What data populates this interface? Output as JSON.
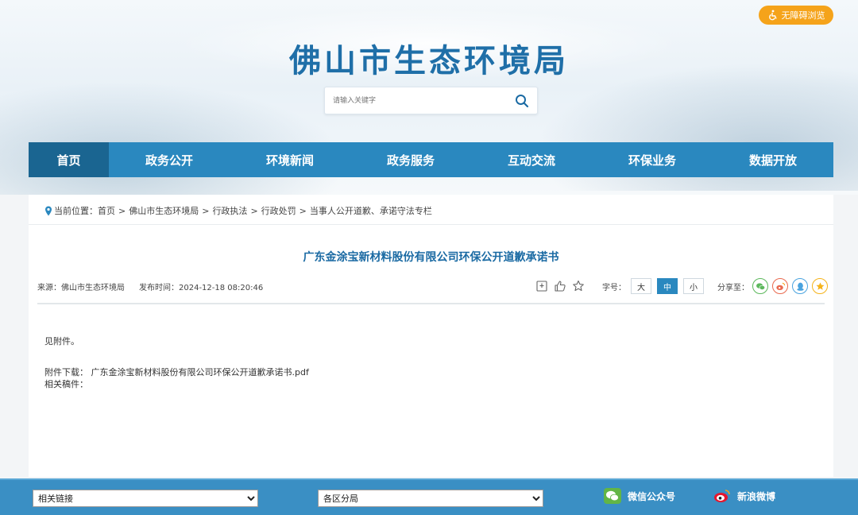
{
  "header": {
    "accessibility_label": "无障碍浏览",
    "site_title": "佛山市生态环境局",
    "search_placeholder": "请输入关键字"
  },
  "nav": {
    "items": [
      {
        "label": "首页",
        "active": true
      },
      {
        "label": "政务公开"
      },
      {
        "label": "环境新闻"
      },
      {
        "label": "政务服务"
      },
      {
        "label": "互动交流"
      },
      {
        "label": "环保业务"
      },
      {
        "label": "数据开放"
      }
    ]
  },
  "breadcrumb": {
    "prefix": "当前位置：",
    "items": [
      "首页",
      "佛山市生态环境局",
      "行政执法",
      "行政处罚",
      "当事人公开道歉、承诺守法专栏"
    ],
    "separator": ">"
  },
  "article": {
    "title": "广东金涂宝新材料股份有限公司环保公开道歉承诺书",
    "source_label": "来源：佛山市生态环境局",
    "published_label": "发布时间：2024-12-18 08:20:46",
    "font_size_label": "字号：",
    "font_sizes": [
      "大",
      "中",
      "小"
    ],
    "font_size_selected": "中",
    "share_label": "分享至：",
    "body": "见附件。",
    "attachment_label": "附件下载：",
    "attachment_file": "广东金涂宝新材料股份有限公司环保公开道歉承诺书.pdf",
    "related_label": "相关稿件："
  },
  "footer": {
    "related_links": "相关链接",
    "district_bureaus": "各区分局",
    "wechat_label": "微信公众号",
    "weibo_label": "新浪微博"
  },
  "colors": {
    "nav_bg": "#2a88bf",
    "nav_active": "#1a6591",
    "title_blue": "#1f6fa8",
    "accessibility_orange": "#f5a31a",
    "footer_bg": "#3a8fc4"
  }
}
